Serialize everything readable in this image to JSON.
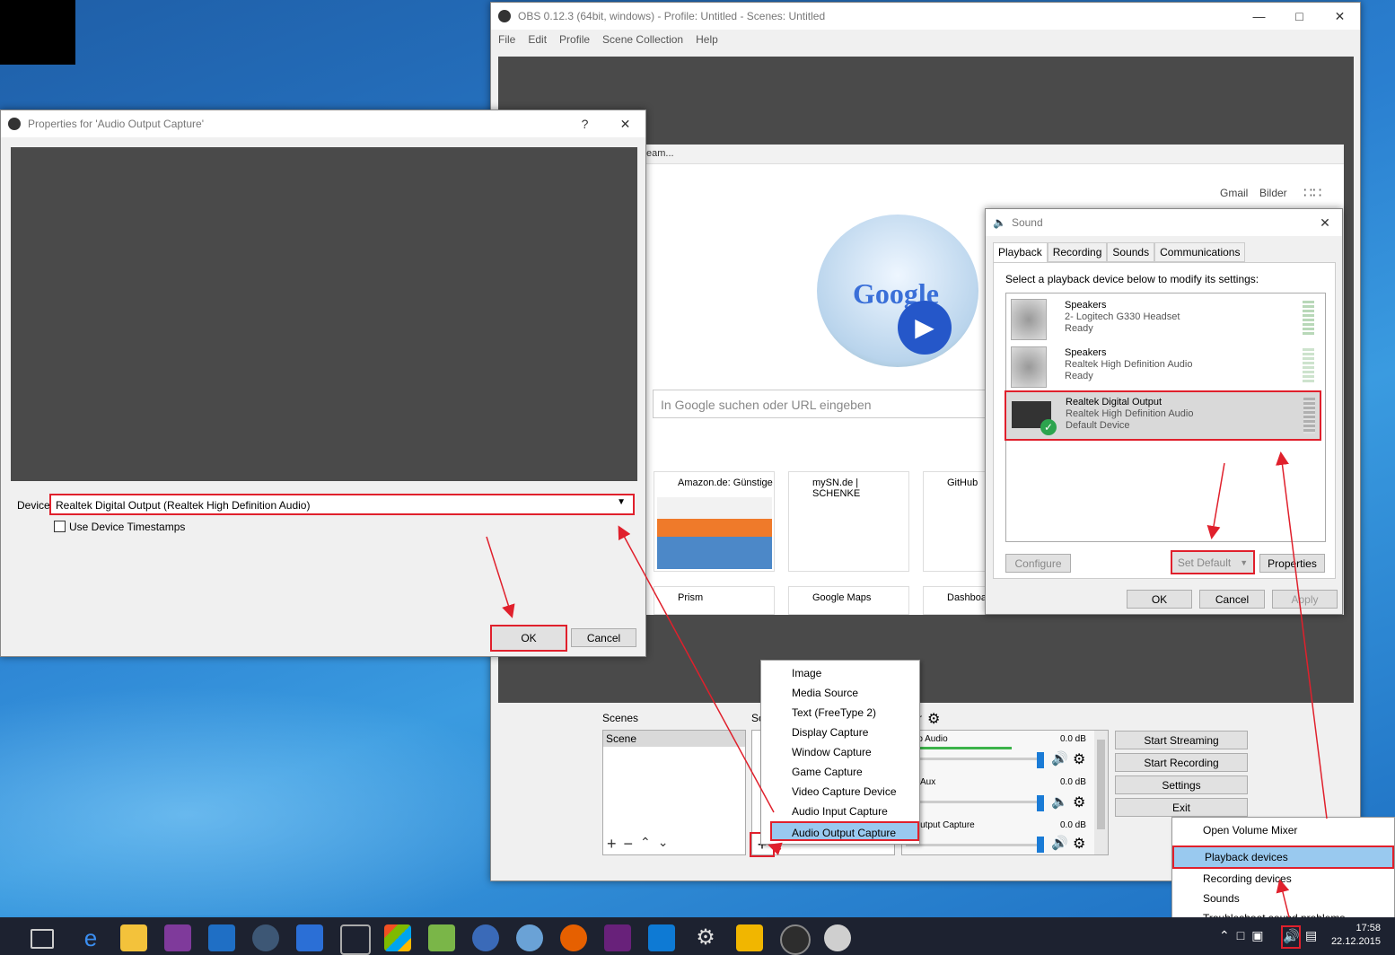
{
  "obs": {
    "title": "OBS 0.12.3 (64bit, windows) - Profile: Untitled - Scenes: Untitled",
    "menu": [
      "File",
      "Edit",
      "Profile",
      "Scene Collection",
      "Help"
    ],
    "scenes_label": "Scenes",
    "sources_label_partial": "Sc",
    "mixer_label_partial": "r",
    "scene_item": "Scene",
    "mixer": [
      {
        "name": "ktop Audio",
        "db": "0.0 dB"
      },
      {
        "name": "Aux",
        "db": "0.0 dB"
      },
      {
        "name": "o Output Capture",
        "db": "0.0 dB"
      }
    ],
    "buttons": [
      "Start Streaming",
      "Start Recording",
      "Settings",
      "Exit"
    ]
  },
  "browser": {
    "address_partial": "eam...",
    "links": [
      "Gmail",
      "Bilder"
    ],
    "search_placeholder": "In Google suchen oder URL eingeben",
    "tiles": [
      "Amazon.de: Günstige",
      "mySN.de | SCHENKE",
      "GitHub",
      "Prism",
      "Google Maps",
      "Dashboa"
    ]
  },
  "props": {
    "title": "Properties for 'Audio Output Capture'",
    "help": "?",
    "device_label": "Device",
    "device_value": "Realtek Digital Output (Realtek High Definition Audio)",
    "timestamps_label": "Use Device Timestamps",
    "ok": "OK",
    "cancel": "Cancel"
  },
  "sound": {
    "title": "Sound",
    "tabs": [
      "Playback",
      "Recording",
      "Sounds",
      "Communications"
    ],
    "instruction": "Select a playback device below to modify its settings:",
    "devices": [
      {
        "name": "Speakers",
        "desc": "2- Logitech G330 Headset",
        "status": "Ready"
      },
      {
        "name": "Speakers",
        "desc": "Realtek High Definition Audio",
        "status": "Ready"
      },
      {
        "name": "Realtek Digital Output",
        "desc": "Realtek High Definition Audio",
        "status": "Default Device"
      }
    ],
    "configure": "Configure",
    "set_default": "Set Default",
    "properties": "Properties",
    "ok": "OK",
    "cancel": "Cancel",
    "apply": "Apply"
  },
  "context_menu": [
    "Image",
    "Media Source",
    "Text (FreeType 2)",
    "Display Capture",
    "Window Capture",
    "Game Capture",
    "Video Capture Device",
    "Audio Input Capture",
    "Audio Output Capture"
  ],
  "tray_menu": [
    "Open Volume Mixer",
    "Playback devices",
    "Recording devices",
    "Sounds",
    "Troubleshoot sound problems"
  ],
  "taskbar": {
    "time": "17:58",
    "date": "22.12.2015"
  },
  "colors": {
    "accent": "#e0202c",
    "selection": "#99c9ef",
    "obs_dark": "#4a4a4a"
  }
}
